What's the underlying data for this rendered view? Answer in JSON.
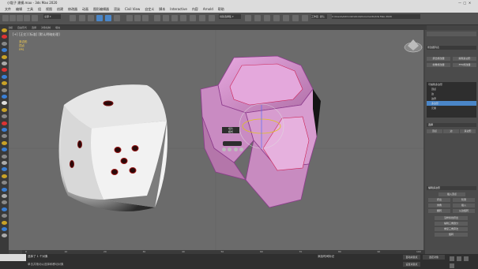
{
  "titlebar": {
    "title": "小骰子 建模.max - 3ds Max 2020"
  },
  "menus": [
    "文件",
    "编辑",
    "工具",
    "组",
    "视图",
    "创建",
    "修改器",
    "动画",
    "图形编辑器",
    "渲染",
    "Civil View",
    "自定义",
    "脚本",
    "Interactive",
    "内容",
    "Arnold",
    "帮助"
  ],
  "workspace_label": "工作区: 默认",
  "filepath": "C:\\Users\\Administrators\\Documents\\3ds Max 2020",
  "ribbon": [
    "建模",
    "自由形式",
    "选择",
    "对象绘制",
    "填充"
  ],
  "viewport": {
    "label": "[+] [正交] [标准] [默认明暗处理]",
    "stats": {
      "l1": "多边形",
      "l2": "顶点",
      "l3": "FPS"
    },
    "quad_label": "切片",
    "quad_mode": "模式"
  },
  "command_panel": {
    "dropdown": "修改器列表",
    "buttons": [
      "挤出修改器",
      "编辑多边形",
      "倒角修改器",
      "FFD修改器"
    ],
    "stack": [
      "可编辑多边形",
      "顶点",
      "边",
      "边界",
      "多边形",
      "元素"
    ],
    "stack_selected": 4,
    "section1": "选择",
    "values": [
      "顶点",
      "边",
      "多边形"
    ],
    "section2": "编辑多边形",
    "buttons2": [
      "插入顶点",
      "挤出",
      "轮廓",
      "倒角",
      "插入",
      "翻转",
      "从边旋转",
      "沿样条线挤出",
      "编辑三角剖分",
      "重复三角算法",
      "旋转"
    ]
  },
  "statusbar": {
    "selection": "选择了 1 个对象",
    "hint": "单击并拖动以选择和移动对象",
    "frame": "0 / 100",
    "add_key": "添加时间标记",
    "auto_key": "自动关键点",
    "set_key": "设置关键点",
    "filter": "选定对象"
  },
  "timeline_ticks": [
    "0",
    "10",
    "20",
    "30",
    "40",
    "50",
    "60",
    "70",
    "80",
    "90",
    "100"
  ]
}
